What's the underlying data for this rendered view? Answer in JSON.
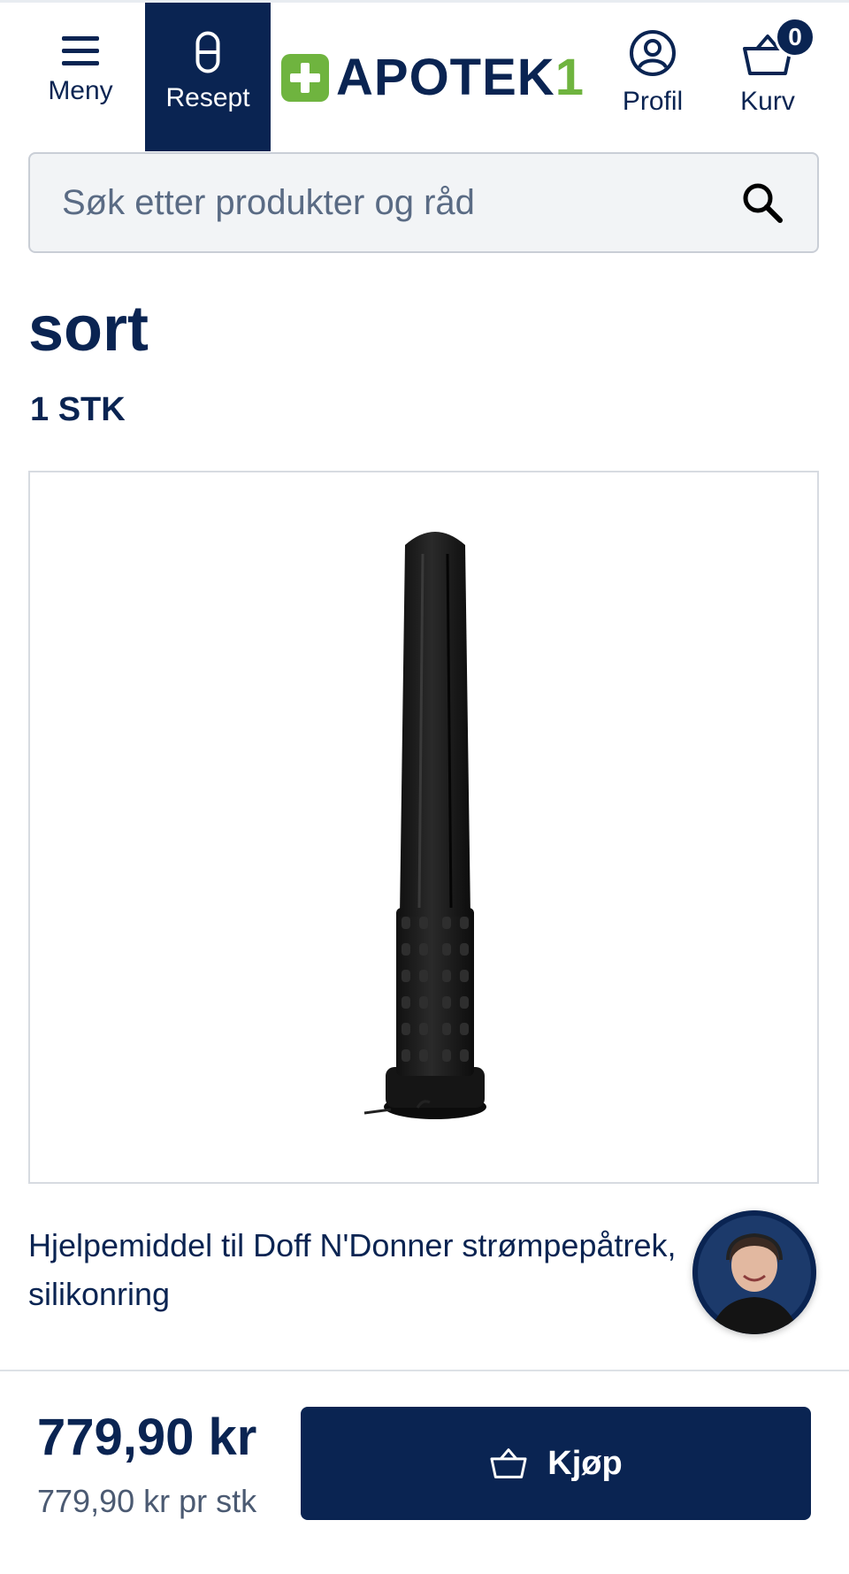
{
  "header": {
    "menu_label": "Meny",
    "resept_label": "Resept",
    "logo_text": "APOTEK",
    "logo_number": "1",
    "profil_label": "Profil",
    "kurv_label": "Kurv",
    "cart_count": "0"
  },
  "search": {
    "placeholder": "Søk etter produkter og råd"
  },
  "product": {
    "title": "sort",
    "quantity": "1 STK",
    "description": "Hjelpemiddel til Doff N'Donner strømpepåtrek, silikonring",
    "price": "779,90 kr",
    "unit_price": "779,90 kr pr stk",
    "buy_label": "Kjøp"
  },
  "colors": {
    "brand_navy": "#0a2452",
    "brand_green": "#6fb43f",
    "search_bg": "#f2f4f6"
  },
  "icons": [
    "menu-icon",
    "capsule-icon",
    "profile-icon",
    "basket-icon",
    "search-icon",
    "plus-cross-icon"
  ]
}
